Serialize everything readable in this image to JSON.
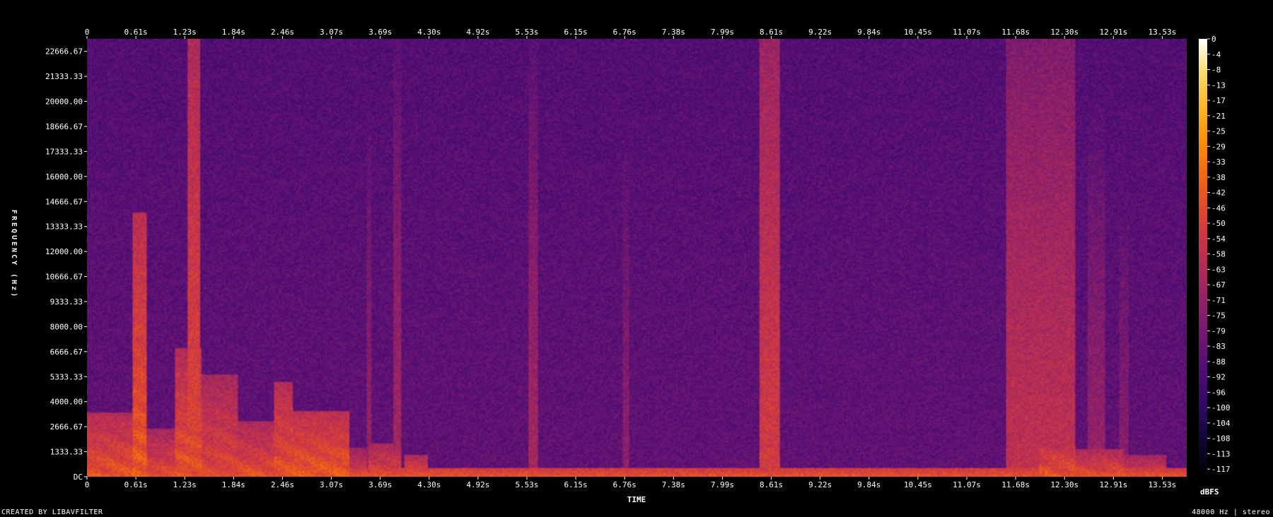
{
  "chart_data": {
    "type": "heatmap",
    "title": "",
    "xlabel": "TIME",
    "ylabel": "FREQUENCY (Hz)",
    "colorbar_label": "dBFS",
    "x_ticks": [
      "0",
      "0.61s",
      "1.23s",
      "1.84s",
      "2.46s",
      "3.07s",
      "3.69s",
      "4.30s",
      "4.92s",
      "5.53s",
      "6.15s",
      "6.76s",
      "7.38s",
      "7.99s",
      "8.61s",
      "9.22s",
      "9.84s",
      "10.45s",
      "11.07s",
      "11.68s",
      "12.30s",
      "12.91s",
      "13.53s"
    ],
    "y_ticks": [
      "DC",
      "1333.33",
      "2666.67",
      "4000.00",
      "5333.33",
      "6666.67",
      "8000.00",
      "9333.33",
      "10666.67",
      "12000.00",
      "13333.33",
      "14666.67",
      "16000.00",
      "17333.33",
      "18666.67",
      "20000.00",
      "21333.33",
      "22666.67"
    ],
    "colorbar_ticks": [
      "0",
      "-4",
      "-8",
      "-13",
      "-17",
      "-21",
      "-25",
      "-29",
      "-33",
      "-38",
      "-42",
      "-46",
      "-50",
      "-54",
      "-58",
      "-63",
      "-67",
      "-71",
      "-75",
      "-79",
      "-83",
      "-88",
      "-92",
      "-96",
      "-100",
      "-104",
      "-108",
      "-113",
      "-117"
    ],
    "xlim": [
      0,
      13.85
    ],
    "ylim": [
      0,
      24000
    ],
    "zlim": [
      -120,
      0
    ],
    "colormap": [
      "#000000",
      "#10062e",
      "#2c0a5e",
      "#4c0c73",
      "#6a1672",
      "#8a1f6a",
      "#a92a5c",
      "#c8354a",
      "#e04a2c",
      "#f26a12",
      "#fb8f0a",
      "#fcb52a",
      "#f8dc6a",
      "#ffffff"
    ],
    "background_level_db": -86,
    "energy_bands": [
      {
        "t_start": 1.27,
        "t_end": 1.42,
        "level_db": -48
      },
      {
        "t_start": 3.52,
        "t_end": 3.58,
        "level_db": -70
      },
      {
        "t_start": 3.85,
        "t_end": 3.95,
        "level_db": -66
      },
      {
        "t_start": 5.56,
        "t_end": 5.68,
        "level_db": -66
      },
      {
        "t_start": 6.75,
        "t_end": 6.83,
        "level_db": -72
      },
      {
        "t_start": 8.46,
        "t_end": 8.72,
        "level_db": -52
      },
      {
        "t_start": 11.57,
        "t_end": 12.45,
        "level_db": -58
      },
      {
        "t_start": 12.6,
        "t_end": 12.82,
        "level_db": -70
      },
      {
        "t_start": 13.0,
        "t_end": 13.12,
        "level_db": -74
      }
    ],
    "speech_segments": [
      {
        "t_start": 0.0,
        "t_end": 0.58,
        "fmax": 3500,
        "level_db": -48
      },
      {
        "t_start": 0.58,
        "t_end": 0.75,
        "fmax": 14500,
        "level_db": -46
      },
      {
        "t_start": 0.75,
        "t_end": 1.1,
        "fmax": 2600,
        "level_db": -52
      },
      {
        "t_start": 1.1,
        "t_end": 1.45,
        "fmax": 7000,
        "level_db": -48
      },
      {
        "t_start": 1.45,
        "t_end": 1.9,
        "fmax": 5600,
        "level_db": -52
      },
      {
        "t_start": 1.9,
        "t_end": 2.35,
        "fmax": 3000,
        "level_db": -50
      },
      {
        "t_start": 2.35,
        "t_end": 2.6,
        "fmax": 5200,
        "level_db": -48
      },
      {
        "t_start": 2.6,
        "t_end": 3.3,
        "fmax": 3600,
        "level_db": -46
      },
      {
        "t_start": 3.3,
        "t_end": 3.52,
        "fmax": 1600,
        "level_db": -56
      },
      {
        "t_start": 3.55,
        "t_end": 3.95,
        "fmax": 1800,
        "level_db": -52
      },
      {
        "t_start": 4.0,
        "t_end": 4.3,
        "fmax": 1200,
        "level_db": -50
      },
      {
        "t_start": 12.0,
        "t_end": 12.45,
        "fmax": 2200,
        "level_db": -48
      },
      {
        "t_start": 12.45,
        "t_end": 13.05,
        "fmax": 1500,
        "level_db": -50
      },
      {
        "t_start": 13.05,
        "t_end": 13.6,
        "fmax": 1200,
        "level_db": -54
      }
    ],
    "bass_band": {
      "fmax": 500,
      "level_db": -44
    }
  },
  "footer": {
    "left": "CREATED BY LIBAVFILTER",
    "right": "48000 Hz | stereo"
  }
}
